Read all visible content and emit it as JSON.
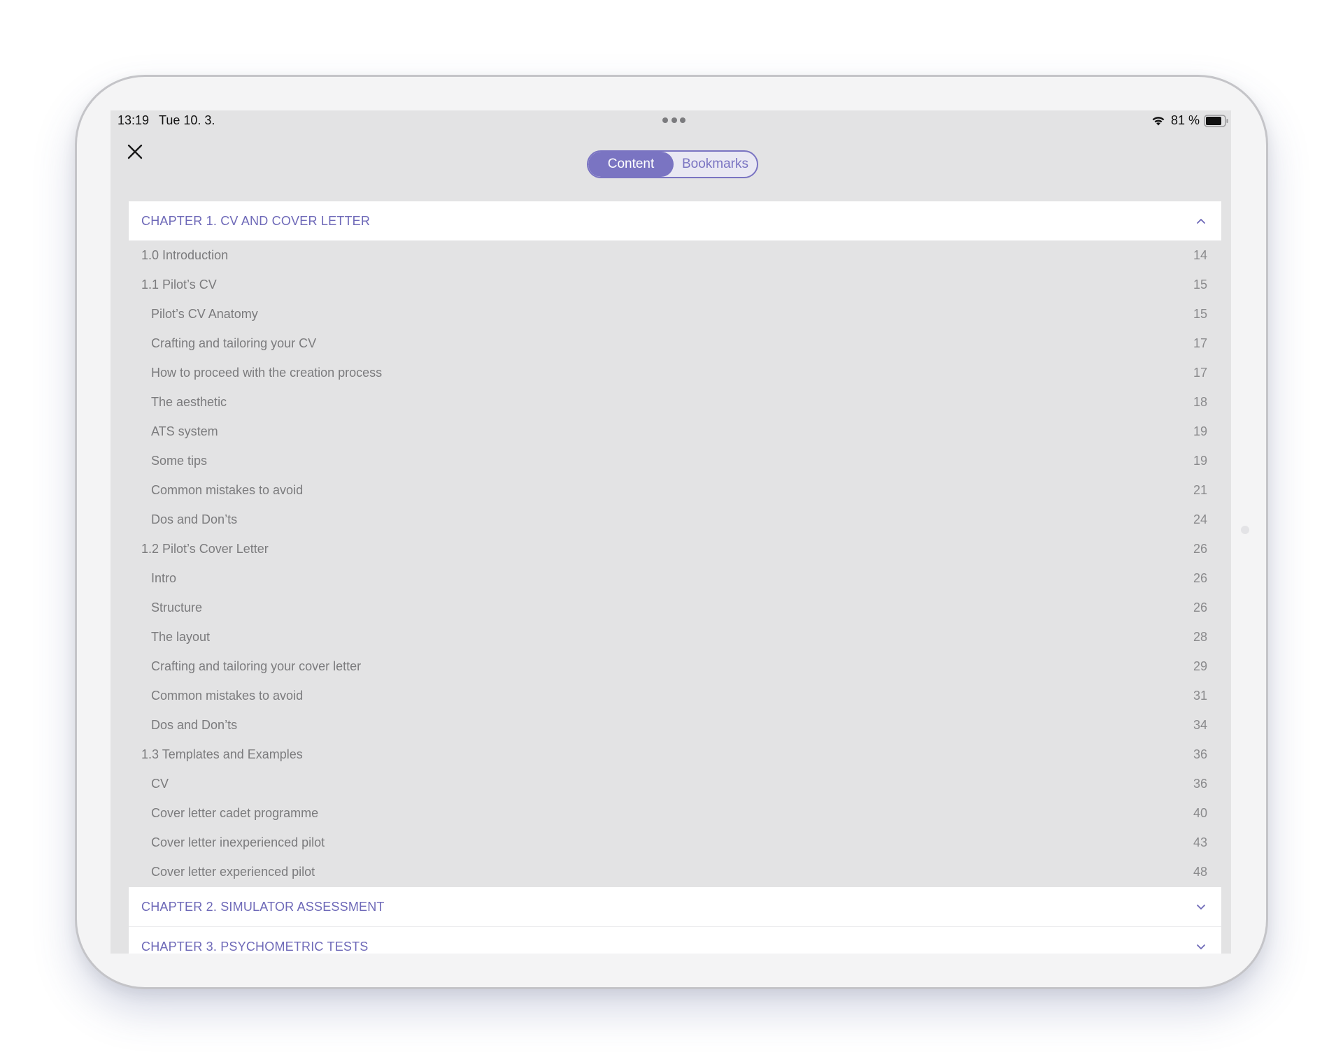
{
  "status_bar": {
    "time": "13:19",
    "date": "Tue 10. 3.",
    "battery": "81 %",
    "icons": [
      "wifi-icon",
      "battery-icon",
      "more-dots-icon"
    ]
  },
  "close_icon": "close-icon",
  "tabs": {
    "content_label": "Content",
    "bookmarks_label": "Bookmarks",
    "selected": "Content"
  },
  "colors": {
    "accent": "#7a74c2",
    "chapter_text": "#6e69b8",
    "background": "#e3e3e4",
    "item_text": "#7b7b7d"
  },
  "chapters": [
    {
      "title": "CHAPTER 1. CV AND COVER LETTER",
      "expanded": true,
      "icon": "chevron-up-icon",
      "items": [
        {
          "label": "1.0 Introduction",
          "page": "14",
          "level": 1
        },
        {
          "label": "1.1 Pilot’s CV",
          "page": "15",
          "level": 1
        },
        {
          "label": "Pilot’s CV Anatomy",
          "page": "15",
          "level": 2
        },
        {
          "label": "Crafting and tailoring your CV",
          "page": "17",
          "level": 2
        },
        {
          "label": "How to proceed with the creation process",
          "page": "17",
          "level": 2
        },
        {
          "label": "The aesthetic",
          "page": "18",
          "level": 2
        },
        {
          "label": "ATS system",
          "page": "19",
          "level": 2
        },
        {
          "label": "Some tips",
          "page": "19",
          "level": 2
        },
        {
          "label": "Common mistakes to avoid",
          "page": "21",
          "level": 2
        },
        {
          "label": "Dos and Don’ts",
          "page": "24",
          "level": 2
        },
        {
          "label": "1.2 Pilot’s Cover Letter",
          "page": "26",
          "level": 1
        },
        {
          "label": "Intro",
          "page": "26",
          "level": 2
        },
        {
          "label": "Structure",
          "page": "26",
          "level": 2
        },
        {
          "label": "The layout",
          "page": "28",
          "level": 2
        },
        {
          "label": "Crafting and tailoring your cover letter",
          "page": "29",
          "level": 2
        },
        {
          "label": "Common mistakes to avoid",
          "page": "31",
          "level": 2
        },
        {
          "label": "Dos and Don’ts",
          "page": "34",
          "level": 2
        },
        {
          "label": "1.3 Templates and Examples",
          "page": "36",
          "level": 1
        },
        {
          "label": "CV",
          "page": "36",
          "level": 2
        },
        {
          "label": "Cover letter cadet programme",
          "page": "40",
          "level": 2
        },
        {
          "label": "Cover letter inexperienced pilot",
          "page": "43",
          "level": 2
        },
        {
          "label": "Cover letter experienced pilot",
          "page": "48",
          "level": 2
        }
      ]
    },
    {
      "title": "CHAPTER 2. SIMULATOR ASSESSMENT",
      "expanded": false,
      "icon": "chevron-down-icon"
    },
    {
      "title": "CHAPTER 3. PSYCHOMETRIC TESTS",
      "expanded": false,
      "icon": "chevron-down-icon"
    }
  ]
}
